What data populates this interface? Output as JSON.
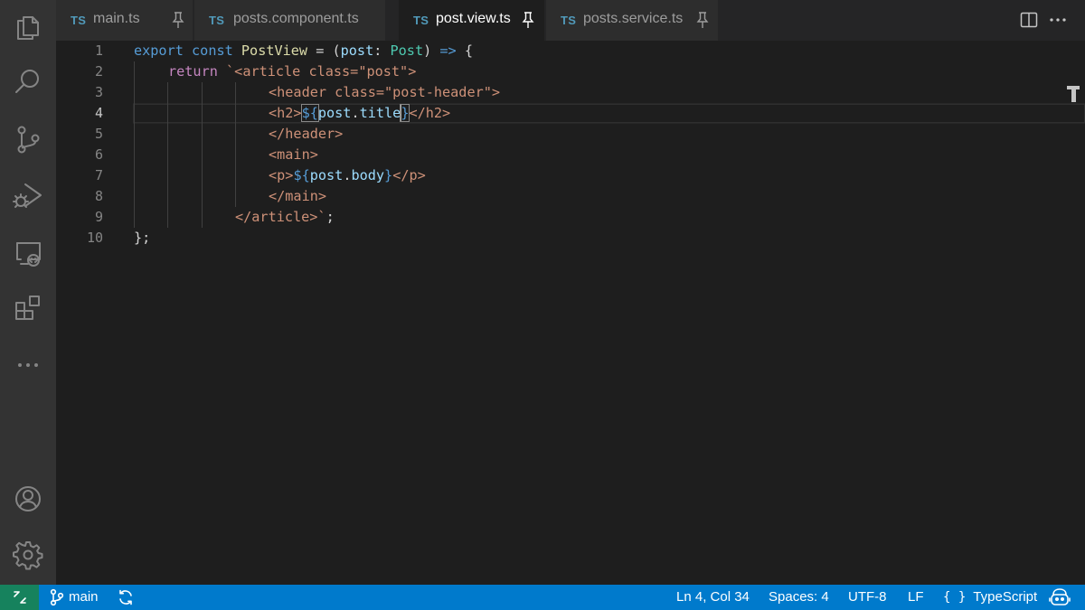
{
  "tabs": [
    {
      "lang": "TS",
      "name": "main.ts",
      "active": false
    },
    {
      "lang": "TS",
      "name": "posts.component.ts",
      "active": false
    },
    {
      "lang": "TS",
      "name": "post.view.ts",
      "active": true
    },
    {
      "lang": "TS",
      "name": "posts.service.ts",
      "active": false
    }
  ],
  "editor_actions": {
    "split_icon": "split-editor-icon",
    "more_icon": "more-actions-icon"
  },
  "activity_bar": [
    "explorer-icon",
    "search-icon",
    "source-control-icon",
    "run-debug-icon",
    "remote-explorer-icon",
    "extensions-icon",
    "more-icon",
    "accounts-icon",
    "manage-gear-icon"
  ],
  "editor": {
    "line_numbers": [
      "1",
      "2",
      "3",
      "4",
      "5",
      "6",
      "7",
      "8",
      "9",
      "10"
    ],
    "active_line": "4",
    "tokens": {
      "l1": [
        "export",
        " ",
        "const",
        " ",
        "PostView",
        " = (",
        "post",
        ": ",
        "Post",
        ") ",
        "=>",
        " {"
      ],
      "l2": [
        "return",
        " ",
        "`<article class=\"post\">"
      ],
      "l3": [
        "<header class=\"post-header\">"
      ],
      "l4": [
        "<h2>",
        "${",
        "post",
        ".",
        "title",
        "}",
        "</h2>"
      ],
      "l5": [
        "</header>"
      ],
      "l6": [
        "<main>"
      ],
      "l7": [
        "<p>",
        "${",
        "post",
        ".",
        "body",
        "}",
        "</p>"
      ],
      "l8": [
        "</main>"
      ],
      "l9": [
        "</article>`",
        ";"
      ],
      "l10": [
        "};"
      ]
    }
  },
  "status_bar": {
    "branch": "main",
    "position": "Ln 4, Col 34",
    "spaces": "Spaces: 4",
    "encoding": "UTF-8",
    "eol": "LF",
    "language": "TypeScript",
    "language_icon": "{ }"
  },
  "colors": {
    "accent": "#007acc",
    "remote": "#16825d",
    "keyword": "#c586c0",
    "storage": "#569cd6",
    "string": "#ce9178",
    "function": "#dcdcaa",
    "type": "#4ec9b0",
    "variable": "#9cdcfe"
  }
}
